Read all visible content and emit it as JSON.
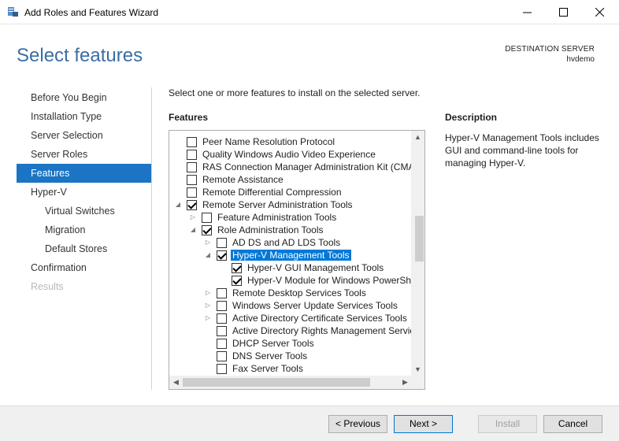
{
  "window": {
    "title": "Add Roles and Features Wizard",
    "minimize_icon": "minimize-icon",
    "maximize_icon": "maximize-icon",
    "close_icon": "close-icon"
  },
  "header": {
    "title": "Select features",
    "destination_label": "DESTINATION SERVER",
    "destination_name": "hvdemo"
  },
  "nav": {
    "items": [
      {
        "label": "Before You Begin",
        "state": "normal"
      },
      {
        "label": "Installation Type",
        "state": "normal"
      },
      {
        "label": "Server Selection",
        "state": "normal"
      },
      {
        "label": "Server Roles",
        "state": "normal"
      },
      {
        "label": "Features",
        "state": "active"
      },
      {
        "label": "Hyper-V",
        "state": "normal"
      },
      {
        "label": "Virtual Switches",
        "state": "sub"
      },
      {
        "label": "Migration",
        "state": "sub"
      },
      {
        "label": "Default Stores",
        "state": "sub"
      },
      {
        "label": "Confirmation",
        "state": "normal"
      },
      {
        "label": "Results",
        "state": "disabled"
      }
    ]
  },
  "main": {
    "intro": "Select one or more features to install on the selected server.",
    "features_heading": "Features",
    "description_heading": "Description",
    "description_text": "Hyper-V Management Tools includes GUI and command-line tools for managing Hyper-V."
  },
  "tree": {
    "rows": [
      {
        "label": "Peer Name Resolution Protocol",
        "level": 0,
        "expander": "",
        "checked": false
      },
      {
        "label": "Quality Windows Audio Video Experience",
        "level": 0,
        "expander": "",
        "checked": false
      },
      {
        "label": "RAS Connection Manager Administration Kit (CMA",
        "level": 0,
        "expander": "",
        "checked": false
      },
      {
        "label": "Remote Assistance",
        "level": 0,
        "expander": "",
        "checked": false
      },
      {
        "label": "Remote Differential Compression",
        "level": 0,
        "expander": "",
        "checked": false
      },
      {
        "label": "Remote Server Administration Tools",
        "level": 0,
        "expander": "expanded",
        "checked": true
      },
      {
        "label": "Feature Administration Tools",
        "level": 1,
        "expander": "collapsed",
        "checked": false
      },
      {
        "label": "Role Administration Tools",
        "level": 1,
        "expander": "expanded",
        "checked": true
      },
      {
        "label": "AD DS and AD LDS Tools",
        "level": 2,
        "expander": "collapsed",
        "checked": false
      },
      {
        "label": "Hyper-V Management Tools",
        "level": 2,
        "expander": "expanded",
        "checked": true,
        "selected": true
      },
      {
        "label": "Hyper-V GUI Management Tools",
        "level": 3,
        "expander": "",
        "checked": true
      },
      {
        "label": "Hyper-V Module for Windows PowerSh",
        "level": 3,
        "expander": "",
        "checked": true
      },
      {
        "label": "Remote Desktop Services Tools",
        "level": 2,
        "expander": "collapsed",
        "checked": false
      },
      {
        "label": "Windows Server Update Services Tools",
        "level": 2,
        "expander": "collapsed",
        "checked": false
      },
      {
        "label": "Active Directory Certificate Services Tools",
        "level": 2,
        "expander": "collapsed",
        "checked": false
      },
      {
        "label": "Active Directory Rights Management Servic",
        "level": 2,
        "expander": "",
        "checked": false
      },
      {
        "label": "DHCP Server Tools",
        "level": 2,
        "expander": "",
        "checked": false
      },
      {
        "label": "DNS Server Tools",
        "level": 2,
        "expander": "",
        "checked": false
      },
      {
        "label": "Fax Server Tools",
        "level": 2,
        "expander": "",
        "checked": false
      }
    ]
  },
  "buttons": {
    "previous": "< Previous",
    "next": "Next >",
    "install": "Install",
    "cancel": "Cancel"
  }
}
